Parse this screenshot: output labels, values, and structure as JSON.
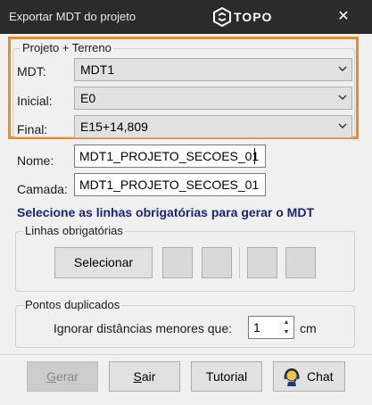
{
  "window": {
    "title": "Exportar MDT do projeto",
    "brand": "TOPO",
    "close_glyph": "✕"
  },
  "projeto": {
    "group_title": "Projeto + Terreno",
    "mdt_label": "MDT:",
    "mdt_value": "MDT1",
    "inicial_label": "Inicial:",
    "inicial_value": "E0",
    "final_label": "Final:",
    "final_value": "E15+14,809"
  },
  "nome": {
    "label": "Nome:",
    "value": "MDT1_PROJETO_SECOES_01"
  },
  "camada": {
    "label": "Camada:",
    "value": "MDT1_PROJETO_SECOES_01"
  },
  "notice": "Selecione as linhas obrigatórias para gerar o MDT",
  "linhas": {
    "group_title": "Linhas obrigatórias",
    "select_button": "Selecionar"
  },
  "pontos": {
    "group_title": "Pontos duplicados",
    "ignore_label": "Ignorar distâncias menores que:",
    "ignore_value": "1",
    "unit": "cm"
  },
  "footer": {
    "gerar_first": "G",
    "gerar_rest": "erar",
    "sair_first": "S",
    "sair_rest": "air",
    "tutorial_label": "Tutorial",
    "chat_label": "Chat"
  },
  "colors": {
    "titlebar": "#2b2b2b",
    "highlight": "#f08a24",
    "notice": "#1a237e"
  },
  "icons": [
    "logo-icon",
    "close-icon",
    "chevron-down-icon",
    "chat-icon"
  ]
}
